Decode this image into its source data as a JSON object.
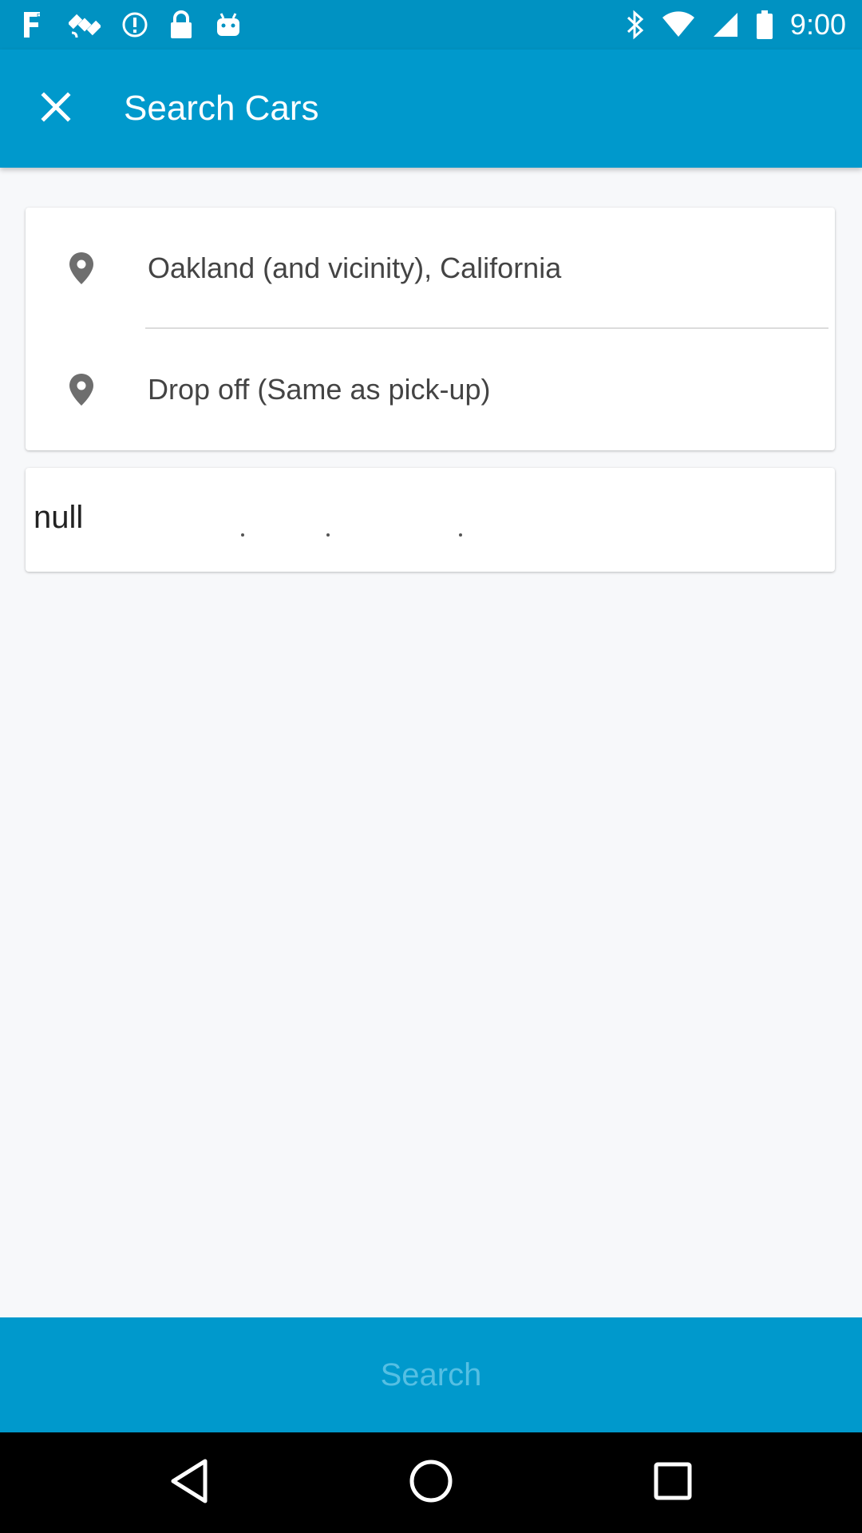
{
  "status_bar": {
    "time": "9:00",
    "left_icons": [
      "fake-gps-icon",
      "satellite-icon",
      "alert-circle-icon",
      "lock-icon",
      "android-icon"
    ],
    "right_icons": [
      "bluetooth-icon",
      "wifi-icon",
      "signal-icon",
      "battery-icon"
    ]
  },
  "app_bar": {
    "title": "Search Cars",
    "close_icon": "close-icon"
  },
  "locations": {
    "pickup": "Oakland (and vicinity), California",
    "dropoff": "Drop off (Same as pick-up)",
    "icon": "location-pin-icon"
  },
  "dates": {
    "value": "null"
  },
  "search_button": {
    "label": "Search"
  },
  "nav_bar": {
    "icons": [
      "back-icon",
      "home-icon",
      "recents-icon"
    ]
  },
  "colors": {
    "primary": "#0099cc",
    "status_bar": "#0092c2",
    "search_label": "#55bfe3",
    "background": "#f7f8fa"
  }
}
